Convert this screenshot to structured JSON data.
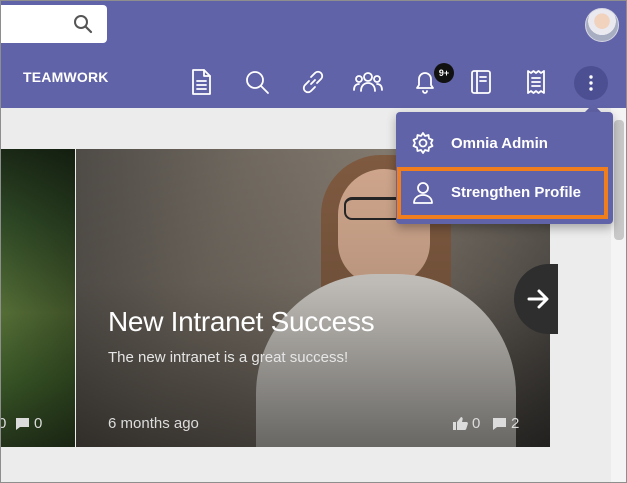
{
  "header": {
    "site_title": "TEAMWORK",
    "notification_badge": "9+",
    "toolbar_icons": [
      "document-icon",
      "search-icon",
      "link-icon",
      "people-icon",
      "bell-icon",
      "book-icon",
      "receipt-icon",
      "more-vertical-icon"
    ]
  },
  "menu": {
    "items": [
      {
        "label": "Omnia Admin",
        "icon": "gear-icon"
      },
      {
        "label": "Strengthen Profile",
        "icon": "user-icon",
        "highlighted": true
      }
    ]
  },
  "slide": {
    "title": "New Intranet Success",
    "description": "The new intranet is a great success!",
    "time": "6 months ago",
    "likes": "0",
    "comments": "2"
  },
  "left_slide": {
    "likes": "0",
    "comments": "0"
  },
  "colors": {
    "brand": "#6163a8",
    "highlight": "#f07d1e"
  }
}
